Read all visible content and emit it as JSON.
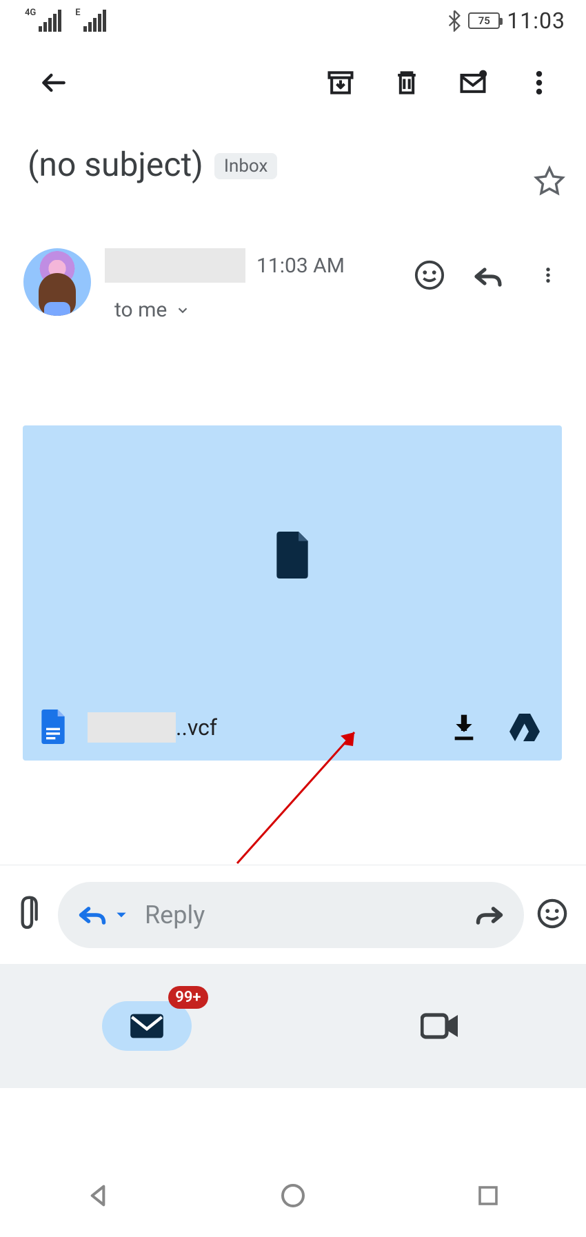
{
  "status_bar": {
    "signal1_label": "4G",
    "signal2_label": "E",
    "battery_percent": "75",
    "time": "11:03"
  },
  "email": {
    "subject": "(no subject)",
    "label": "Inbox",
    "time": "11:03 AM",
    "recipient_line": "to me"
  },
  "attachment": {
    "file_ext": "..vcf"
  },
  "reply": {
    "placeholder": "Reply"
  },
  "bottom": {
    "badge": "99+"
  }
}
